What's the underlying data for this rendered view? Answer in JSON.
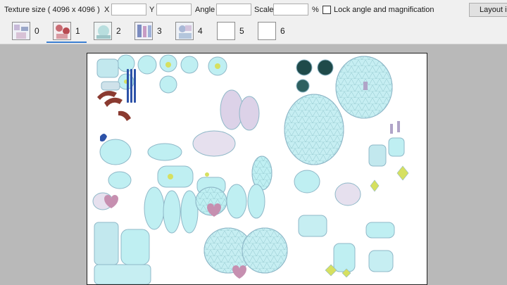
{
  "toolbar": {
    "texture_size": "Texture size ( 4096 x 4096 )",
    "x_label": "X",
    "y_label": "Y",
    "angle_label": "Angle",
    "scale_label": "Scale",
    "percent_label": "%",
    "lock_label": "Lock angle and magnification",
    "layout_button": "Layout in",
    "x_value": "",
    "y_value": "",
    "angle_value": "",
    "scale_value": ""
  },
  "tabs": [
    {
      "label": "0"
    },
    {
      "label": "1",
      "selected": true
    },
    {
      "label": "2"
    },
    {
      "label": "3"
    },
    {
      "label": "4"
    },
    {
      "label": "5"
    },
    {
      "label": "6"
    }
  ],
  "colors": {
    "accent": "#3b7fd1",
    "uv_fill": "#bfeff2",
    "uv_edge": "#8fb8c8",
    "uv_dark": "#1f4a4a",
    "uv_red": "#8a3a30",
    "uv_blue": "#2d52a8",
    "uv_yellow": "#d6e060",
    "uv_pink": "#c68fb0"
  }
}
